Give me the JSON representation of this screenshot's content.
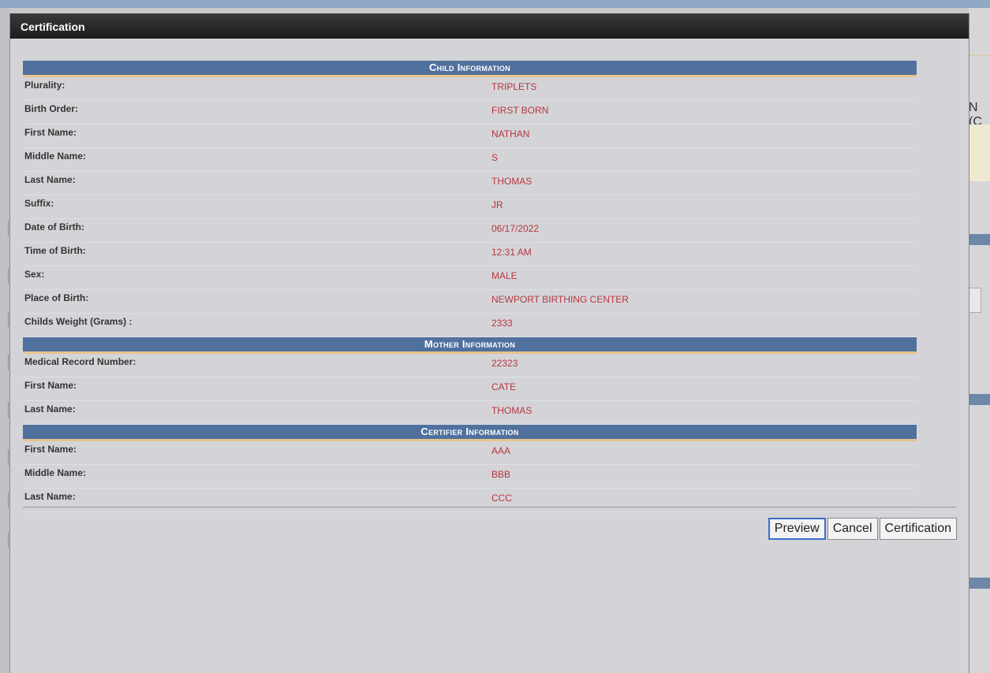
{
  "background": {
    "partial_text": "N (C"
  },
  "dialog": {
    "title": "Certification"
  },
  "sections": [
    {
      "title": "Child Information",
      "rows": [
        {
          "label": "Plurality:",
          "value": "TRIPLETS"
        },
        {
          "label": "Birth Order:",
          "value": "FIRST BORN"
        },
        {
          "label": "First Name:",
          "value": "NATHAN"
        },
        {
          "label": "Middle Name:",
          "value": "S"
        },
        {
          "label": "Last Name:",
          "value": "THOMAS"
        },
        {
          "label": "Suffix:",
          "value": "JR"
        },
        {
          "label": "Date of Birth:",
          "value": "06/17/2022"
        },
        {
          "label": "Time of Birth:",
          "value": "12:31 AM"
        },
        {
          "label": "Sex:",
          "value": "MALE"
        },
        {
          "label": "Place of Birth:",
          "value": "NEWPORT BIRTHING CENTER"
        },
        {
          "label": "Childs Weight (Grams) :",
          "value": "2333"
        }
      ]
    },
    {
      "title": "Mother Information",
      "rows": [
        {
          "label": "Medical Record Number:",
          "value": "22323"
        },
        {
          "label": "First Name:",
          "value": "CATE"
        },
        {
          "label": "Last Name:",
          "value": "THOMAS"
        }
      ]
    },
    {
      "title": "Certifier Information",
      "rows": [
        {
          "label": "First Name:",
          "value": "AAA"
        },
        {
          "label": "Middle Name:",
          "value": "BBB"
        },
        {
          "label": "Last Name:",
          "value": "CCC"
        }
      ]
    }
  ],
  "buttons": {
    "preview": "Preview",
    "cancel": "Cancel",
    "certification": "Certification"
  },
  "colors": {
    "header_bg": "#50719e",
    "header_underline": "#e6c48d",
    "value_text": "#b5373e",
    "titlebar": "#1d1d1d"
  }
}
